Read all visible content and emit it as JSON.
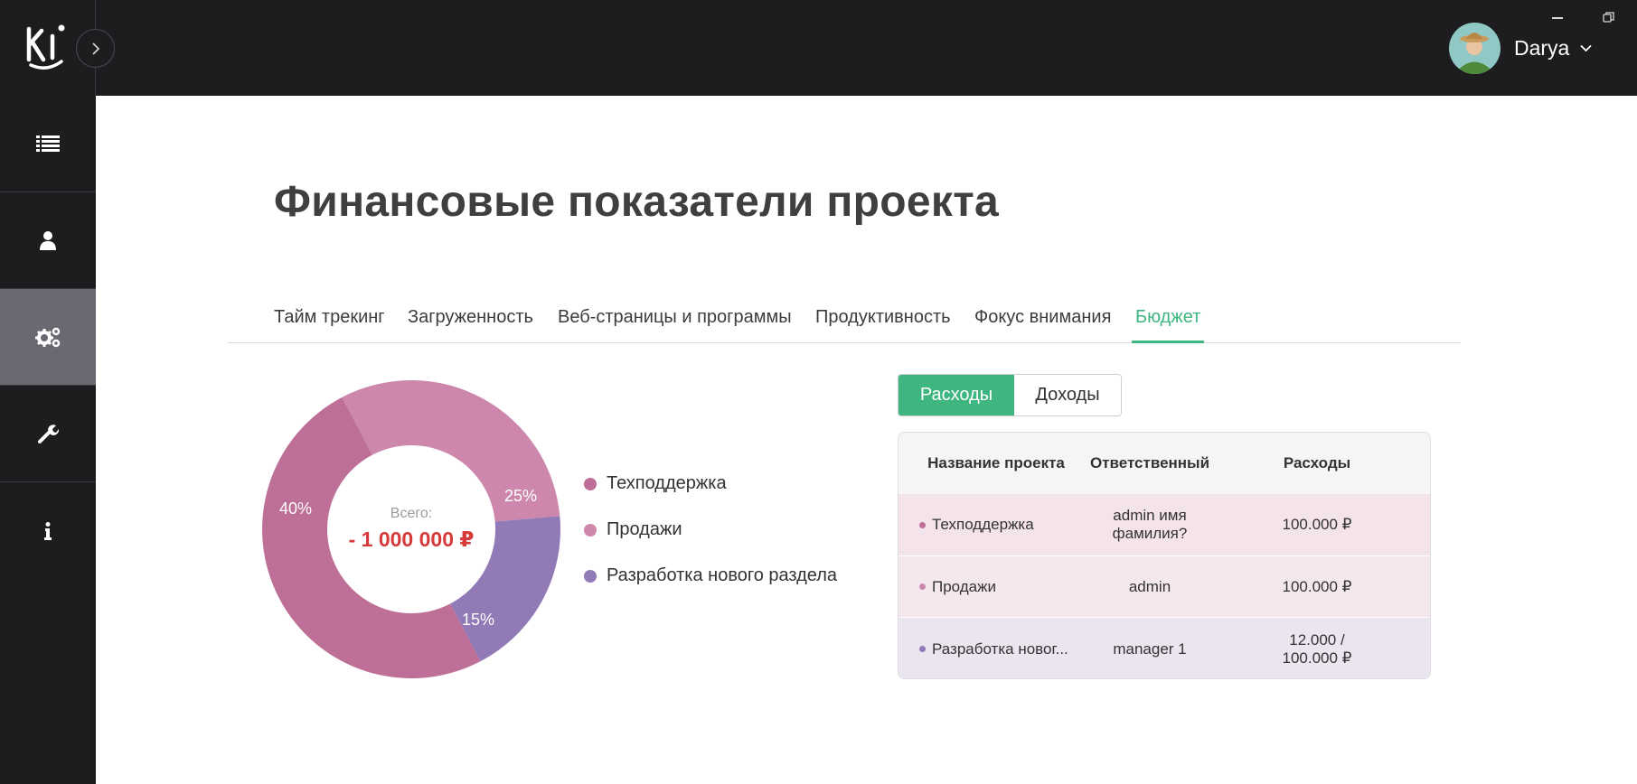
{
  "app": {
    "logo_text": "Ki"
  },
  "user": {
    "name": "Darya"
  },
  "sidebar": {
    "items": [
      {
        "icon": "list-icon"
      },
      {
        "icon": "user-icon"
      },
      {
        "icon": "gears-icon"
      },
      {
        "icon": "wrench-icon"
      },
      {
        "icon": "info-icon"
      }
    ],
    "active_index": 2
  },
  "page": {
    "title": "Финансовые показатели проекта"
  },
  "tabs": [
    {
      "label": "Тайм трекинг"
    },
    {
      "label": "Загруженность"
    },
    {
      "label": "Веб-страницы и программы"
    },
    {
      "label": "Продуктивность"
    },
    {
      "label": "Фокус внимания"
    },
    {
      "label": "Бюджет"
    }
  ],
  "active_tab": "Бюджет",
  "donut": {
    "total_label": "Всего:",
    "total_value": "- 1 000 000 ₽",
    "segments": [
      {
        "name": "Техподдержка",
        "percent": 40,
        "label": "40%",
        "color": "#be6f97"
      },
      {
        "name": "Продажи",
        "percent": 25,
        "label": "25%",
        "color": "#cd87ad"
      },
      {
        "name": "Разработка нового раздела",
        "percent": 15,
        "label": "15%",
        "color": "#917ab6"
      }
    ]
  },
  "legend": [
    {
      "label": "Техподдержка",
      "color": "#be6f97"
    },
    {
      "label": "Продажи",
      "color": "#cd87ad"
    },
    {
      "label": "Разработка нового раздела",
      "color": "#917ab6"
    }
  ],
  "toggle": {
    "expenses": "Расходы",
    "income": "Доходы",
    "selected": "Расходы"
  },
  "table": {
    "headers": [
      "Название проекта",
      "Ответственный",
      "Расходы"
    ],
    "rows": [
      {
        "project": "Техподдержка",
        "owner": "admin имя фамилия?",
        "amount": "100.000 ₽",
        "dot": "#be6f97"
      },
      {
        "project": "Продажи",
        "owner": "admin",
        "amount": "100.000 ₽",
        "dot": "#cd87ad"
      },
      {
        "project": "Разработка новог...",
        "owner": "manager 1",
        "amount": "12.000 / 100.000 ₽",
        "dot": "#917ab6"
      }
    ]
  },
  "colors": {
    "accent": "#3fb57f",
    "sidebar_bg": "#1d1c1f",
    "negative": "#d63a3a"
  }
}
